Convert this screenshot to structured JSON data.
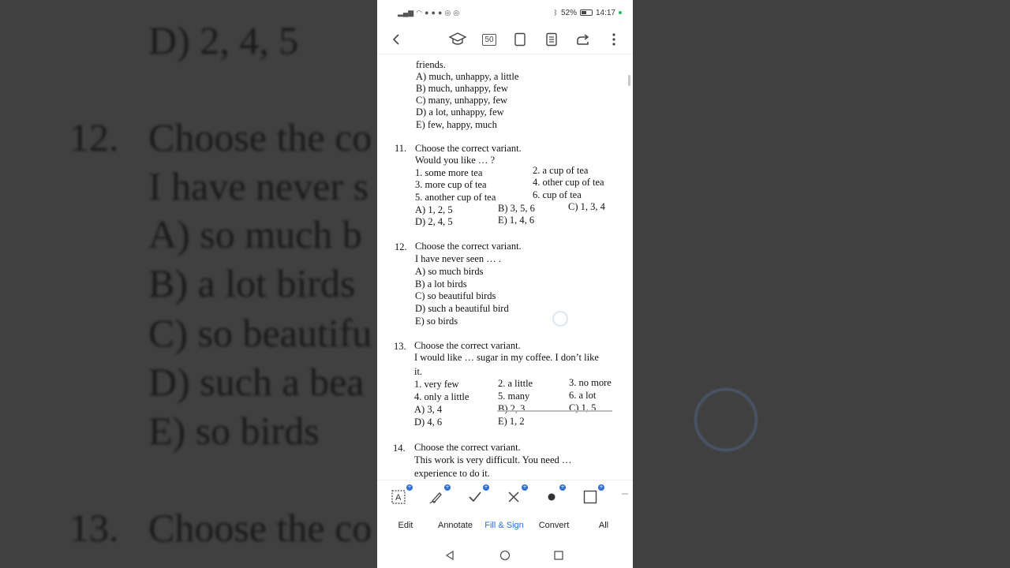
{
  "background": {
    "lines": [
      "D) 2, 4, 5",
      "12.",
      "Choose the co",
      "I have never s",
      "A) so much b",
      "B) a lot birds",
      "C) so beautifu",
      "D) such a bea",
      "E) so birds",
      "13.",
      "Choose the co"
    ]
  },
  "status_bar": {
    "battery": "52%",
    "time": "14:17"
  },
  "toolbar": {
    "page_count": "50"
  },
  "document": {
    "prev_tail": [
      "friends.",
      "A) much, unhappy, a little",
      "B) much, unhappy, few",
      "C) many, unhappy, few",
      "D) a lot, unhappy, few",
      "E) few, happy, much"
    ],
    "q11": {
      "num": "11.",
      "prompt": "Choose the correct variant.",
      "stem": "Would you like … ?",
      "opts": [
        "1. some more tea",
        "2. a cup of tea",
        "3. more cup of tea",
        "4. other cup of tea",
        "5. another cup of tea",
        "6. cup of tea"
      ],
      "answers": [
        "A) 1, 2, 5",
        "B) 3, 5, 6",
        "C) 1, 3, 4",
        "D) 2, 4, 5",
        "E) 1, 4, 6"
      ]
    },
    "q12": {
      "num": "12.",
      "prompt": "Choose the correct variant.",
      "stem": "I have never seen … .",
      "answers": [
        "A) so much birds",
        "B) a lot birds",
        "C) so beautiful birds",
        "D) such a beautiful bird",
        "E) so birds"
      ]
    },
    "q13": {
      "num": "13.",
      "prompt": "Choose the correct variant.",
      "stem1": "I would like … sugar in my coffee. I don’t like",
      "stem2": "it.",
      "opts": [
        "1. very few",
        "2. a little",
        "3. no more",
        "4. only a little",
        "5. many",
        "6. a lot"
      ],
      "answers": [
        "A) 3, 4",
        "B) 2, 3",
        "C) 1, 5",
        "D) 4, 6",
        "E) 1, 2"
      ]
    },
    "q14": {
      "num": "14.",
      "prompt": "Choose the correct variant.",
      "stem1": "This work is very difficult. You need …",
      "stem2": "experience to do it."
    }
  },
  "annot_icons": [
    "text-box-icon",
    "pen-icon",
    "checkmark-icon",
    "cross-icon",
    "dot-icon",
    "rectangle-icon"
  ],
  "tabs": [
    "Edit",
    "Annotate",
    "Fill & Sign",
    "Convert",
    "All"
  ],
  "colors": {
    "accent": "#2e6fd8"
  }
}
